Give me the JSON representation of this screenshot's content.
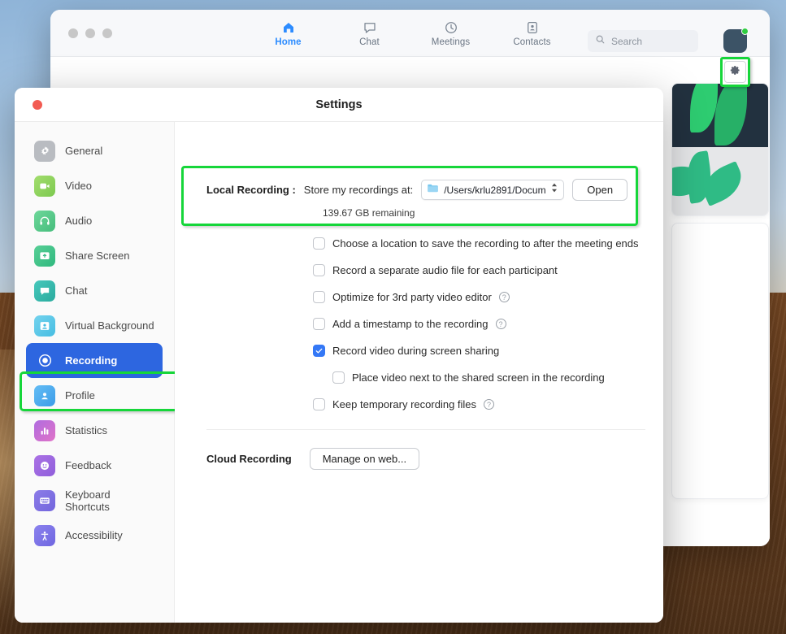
{
  "window": {
    "traffic_lights": [
      "close",
      "minimize",
      "maximize"
    ],
    "nav_tabs": [
      {
        "label": "Home",
        "icon": "home-icon",
        "active": true
      },
      {
        "label": "Chat",
        "icon": "chat-bubble-icon",
        "active": false
      },
      {
        "label": "Meetings",
        "icon": "clock-icon",
        "active": false
      },
      {
        "label": "Contacts",
        "icon": "contact-card-icon",
        "active": false
      }
    ],
    "search": {
      "placeholder": "Search",
      "icon": "search-icon"
    },
    "avatar": {
      "name": "avatar",
      "status_color": "#2ecc40"
    },
    "gear_button": {
      "icon": "gear-icon",
      "highlight_color": "#16d63a"
    }
  },
  "settings": {
    "title": "Settings",
    "close_button": "close-window-button",
    "sidebar": {
      "items": [
        {
          "label": "General",
          "icon": "gear-icon",
          "color": "#b9bcc1",
          "active": false
        },
        {
          "label": "Video",
          "icon": "video-camera-icon",
          "color": "#8dd35f",
          "active": false
        },
        {
          "label": "Audio",
          "icon": "headphones-icon",
          "color": "#5cc98c",
          "active": false
        },
        {
          "label": "Share Screen",
          "icon": "share-screen-icon",
          "color": "#41c48a",
          "active": false
        },
        {
          "label": "Chat",
          "icon": "chat-bubble-icon",
          "color": "#35b8a8",
          "active": false
        },
        {
          "label": "Virtual Background",
          "icon": "person-frame-icon",
          "color": "#5bc8e8",
          "active": false
        },
        {
          "label": "Recording",
          "icon": "record-dot-icon",
          "color": "#2d66e0",
          "active": true
        },
        {
          "label": "Profile",
          "icon": "person-icon",
          "color": "#4aa8ef",
          "active": false
        },
        {
          "label": "Statistics",
          "icon": "bar-chart-icon",
          "color": "#cc6ad0",
          "active": false
        },
        {
          "label": "Feedback",
          "icon": "smiley-face-icon",
          "color": "#a06ae0",
          "active": false
        },
        {
          "label": "Keyboard Shortcuts",
          "icon": "keyboard-icon",
          "color": "#8071e0",
          "active": false
        },
        {
          "label": "Accessibility",
          "icon": "accessibility-icon",
          "color": "#7a75e8",
          "active": false
        }
      ],
      "highlighted_item": "Recording"
    },
    "recording_panel": {
      "local_recording_label": "Local Recording :",
      "store_label": "Store my recordings at:",
      "path_value": "/Users/krlu2891/Docum...",
      "path_icon": "folder-icon",
      "stepper_icon": "up-down-chevron-icon",
      "open_button": "Open",
      "remaining_text": "139.67 GB remaining",
      "checkboxes": [
        {
          "label": "Choose a location to save the recording to after the meeting ends",
          "checked": false,
          "nested": false,
          "help": false
        },
        {
          "label": "Record a separate audio file for each participant",
          "checked": false,
          "nested": false,
          "help": false
        },
        {
          "label": "Optimize for 3rd party video editor",
          "checked": false,
          "nested": false,
          "help": true
        },
        {
          "label": "Add a timestamp to the recording",
          "checked": false,
          "nested": false,
          "help": true
        },
        {
          "label": "Record video during screen sharing",
          "checked": true,
          "nested": false,
          "help": false
        },
        {
          "label": "Place video next to the shared screen in the recording",
          "checked": false,
          "nested": true,
          "help": false
        },
        {
          "label": "Keep temporary recording files",
          "checked": false,
          "nested": false,
          "help": true
        }
      ],
      "cloud_recording_label": "Cloud Recording",
      "manage_button": "Manage on web..."
    }
  }
}
